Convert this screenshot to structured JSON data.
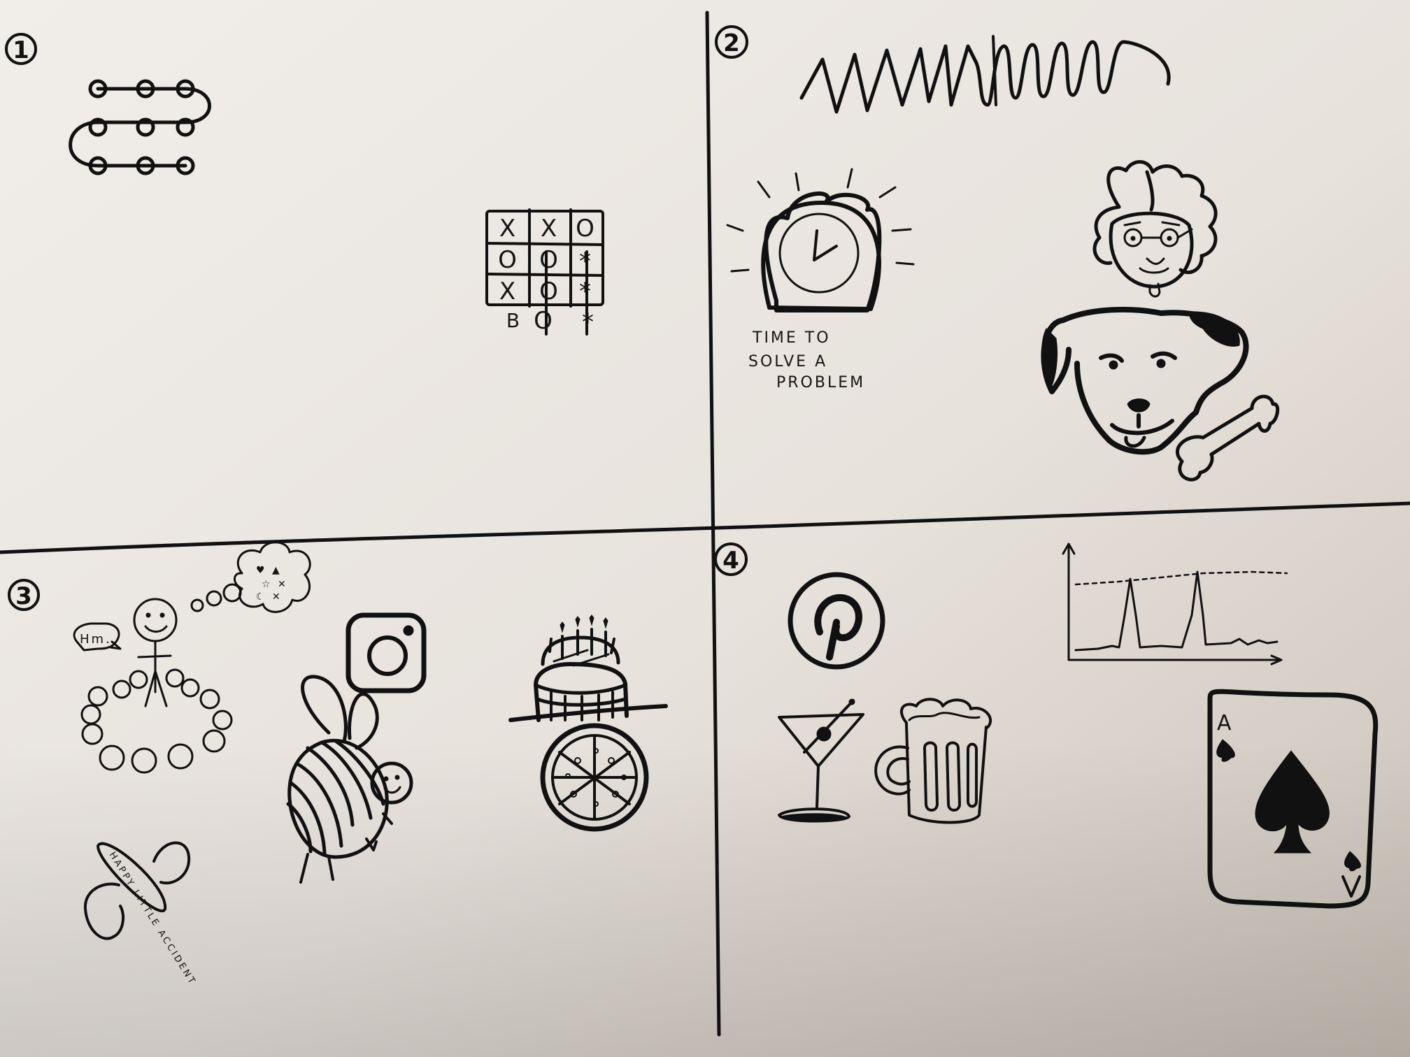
{
  "quadrants": {
    "q1": {
      "number": "1"
    },
    "q2": {
      "number": "2",
      "clock_caption_lines": [
        "TIME TO",
        "SOLVE A",
        "PROBLEM"
      ]
    },
    "q3": {
      "number": "3",
      "speech_bubble": "Hm..",
      "pacifier_text": "HAPPY LITTLE ACCIDENT"
    },
    "q4": {
      "number": "4",
      "card_rank": "A"
    }
  },
  "tictactoe": {
    "cells": [
      "X",
      "X",
      "O",
      "O",
      "O",
      "*",
      "X",
      "O",
      "*"
    ],
    "below_row": [
      "B",
      "O",
      "*"
    ]
  },
  "colors": {
    "paper": "#eae6e0",
    "paper_shadow": "#b9b1a7",
    "ink": "#111111"
  }
}
